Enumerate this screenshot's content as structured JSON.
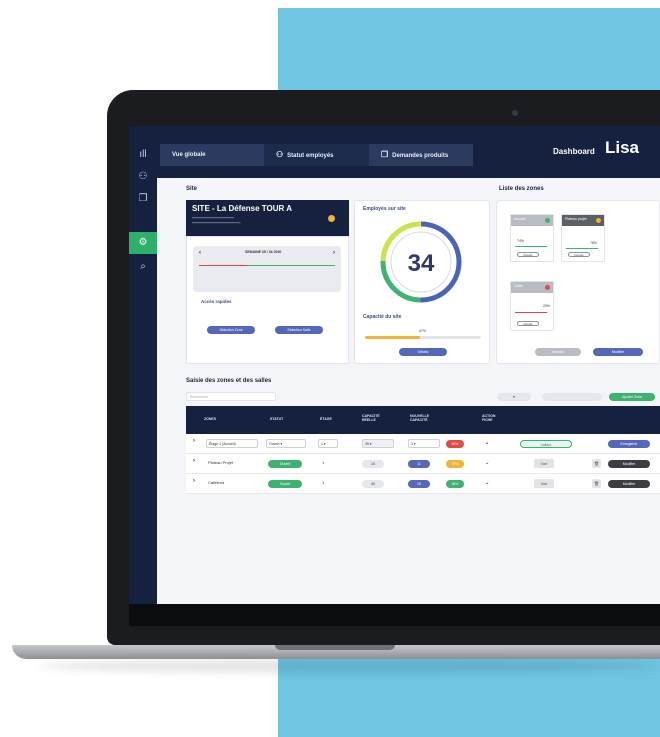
{
  "nav": {
    "tabs": [
      {
        "label": "Vue globale",
        "icon": ""
      },
      {
        "label": "Statut employés",
        "icon": "people-icon"
      },
      {
        "label": "Demandes produits",
        "icon": "box-icon"
      }
    ],
    "dashboard_label": "Dashboard",
    "brand": "Lisa"
  },
  "sidebar": {
    "items": [
      {
        "icon": "chart-icon",
        "glyph": "ıll"
      },
      {
        "icon": "people-icon",
        "glyph": "⚇"
      },
      {
        "icon": "box-icon",
        "glyph": "❐"
      },
      {
        "icon": "gear-icon",
        "glyph": "⚙"
      },
      {
        "icon": "search-icon",
        "glyph": "⌕"
      }
    ]
  },
  "site": {
    "section_title": "Site",
    "name": "SITE - La Défense TOUR A",
    "quick_actions_title": "Accès rapides",
    "actions": [
      "Sélection Zone",
      "Sélection Salle"
    ],
    "week_label": "SEMAINE 35 / 34 2020",
    "status_color": "#f2b233"
  },
  "employees": {
    "title": "Employés sur site",
    "count": "34",
    "capacity_title": "Capacité du site",
    "capacity_percent": "47%",
    "capacity_value": 0.47,
    "details_button": "Détails"
  },
  "zones": {
    "title": "Liste des zones",
    "cards": [
      {
        "name": "Accueil",
        "dot": "#3cb371",
        "pct": "74%"
      },
      {
        "name": "Plateau projet",
        "dot": "#f2b233",
        "pct": "78%"
      },
      {
        "name": "Cafés",
        "dot": "#e04a3f",
        "pct": "20%"
      }
    ],
    "card_button": "Détails",
    "cancel_button": "Annuler",
    "modify_button": "Modifier"
  },
  "table": {
    "title": "Saisie des zones et des salles",
    "search_placeholder": "Rechercher",
    "add_button": "Ajouter Zone",
    "headers": [
      "ZONES",
      "STATUT",
      "ÉTAGE",
      "CAPACITÉ RÉELLE",
      "NOUVELLE CAPACITÉ",
      "ACTION FICHE"
    ],
    "rows": [
      {
        "zone": "Étage 1 (Accueil)",
        "status": "Ouvert",
        "floor": "1",
        "cap": "35",
        "new_cap": "3",
        "pct": "20%",
        "pct_color": "#e04a3f",
        "action": "Valider",
        "save": "Enregistrer"
      },
      {
        "zone": "Plateau Projet",
        "status": "Ouvert",
        "floor": "1",
        "cap": "15",
        "new_cap": "11",
        "pct": "73%",
        "pct_color": "#f2b233",
        "action": "Voir",
        "save": "Modifier"
      },
      {
        "zone": "Cafétéria",
        "status": "Ouvert",
        "floor": "1",
        "cap": "40",
        "new_cap": "15",
        "pct": "38%",
        "pct_color": "#3cb371",
        "action": "Voir",
        "save": "Modifier"
      }
    ]
  },
  "colors": {
    "navy": "#15213f",
    "accent_green": "#2fb06a",
    "accent_blue": "#5567b8",
    "backdrop": "#6ec6e2"
  }
}
